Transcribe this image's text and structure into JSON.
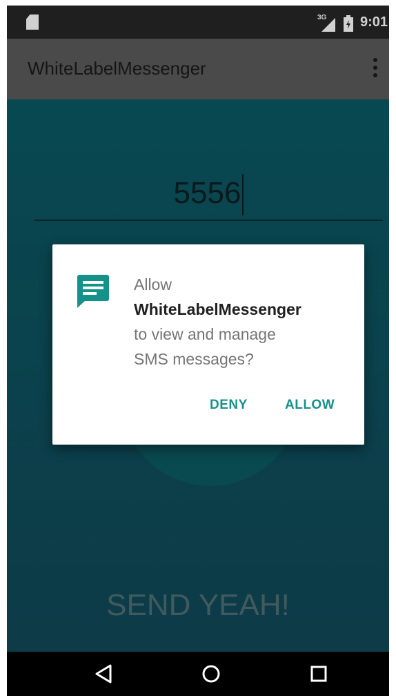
{
  "status_bar": {
    "network_type": "3G",
    "time": "9:01"
  },
  "app_bar": {
    "title": "WhiteLabelMessenger",
    "overflow_icon": "more-vert-icon"
  },
  "main": {
    "number_value": "5556",
    "send_button_label": "SEND YEAH!"
  },
  "dialog": {
    "icon": "sms-message-icon",
    "line_allow": "Allow",
    "app_name": "WhiteLabelMessenger",
    "line_1": "to view and manage",
    "line_2": "SMS messages?",
    "deny_label": "DENY",
    "allow_label": "ALLOW"
  },
  "nav_bar": {
    "back": "back-icon",
    "home": "home-icon",
    "recents": "recents-icon"
  },
  "colors": {
    "accent": "#14928A",
    "content_background": "#0B5560",
    "app_bar": "#5B5B5B"
  }
}
